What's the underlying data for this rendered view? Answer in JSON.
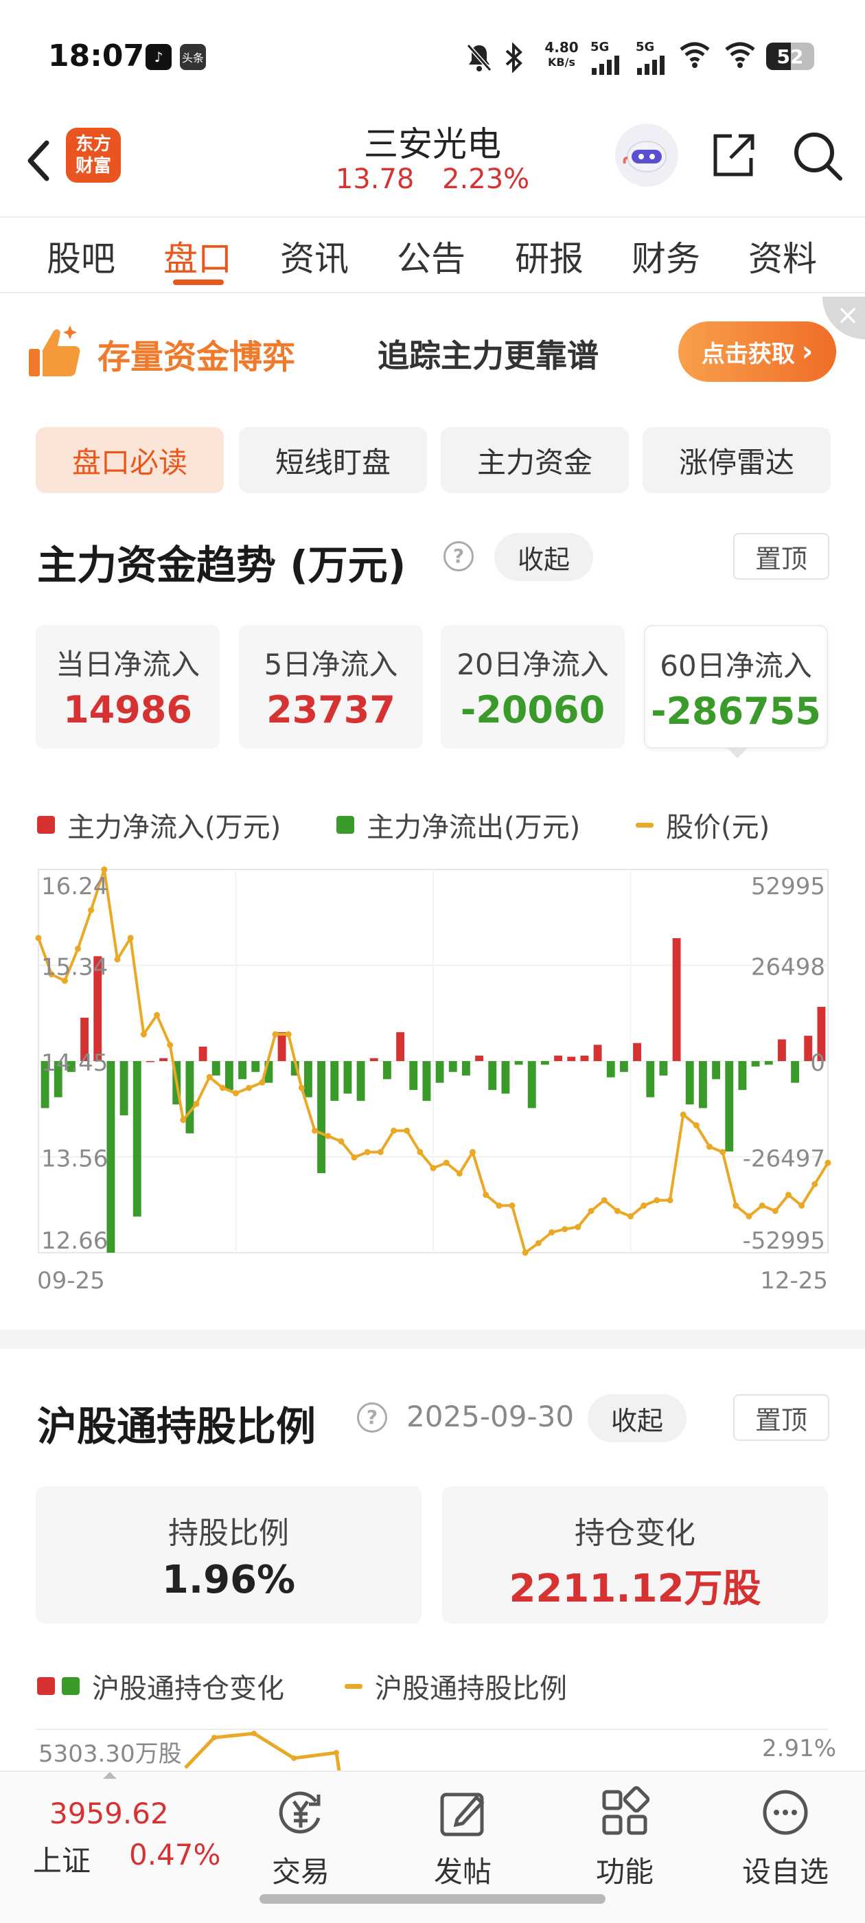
{
  "status_bar": {
    "time": "18:07",
    "net_speed_value": "4.80",
    "net_speed_unit": "KB/s",
    "signal_1": "5G",
    "signal_2": "5G",
    "battery": "52",
    "app_icon_2": "头条"
  },
  "header": {
    "logo_line1": "东方",
    "logo_line2": "财富",
    "stock_name": "三安光电",
    "price": "13.78",
    "change_pct": "2.23%",
    "icons": [
      "back-icon",
      "assistant-robot-icon",
      "share-icon",
      "search-icon"
    ]
  },
  "tabs": [
    "股吧",
    "盘口",
    "资讯",
    "公告",
    "研报",
    "财务",
    "资料"
  ],
  "active_tab": "盘口",
  "banner": {
    "left_text": "存量资金博弈",
    "mid_text": "追踪主力更靠谱",
    "button": "点击获取",
    "button_chevron": "›",
    "close": "×"
  },
  "sub_tabs": [
    "盘口必读",
    "短线盯盘",
    "主力资金",
    "涨停雷达"
  ],
  "active_sub_tab": "盘口必读",
  "fund_trend": {
    "title": "主力资金趋势 (万元)",
    "help": "?",
    "collapse_btn": "收起",
    "pin_btn": "置顶",
    "cards": [
      {
        "label": "当日净流入",
        "value": "14986",
        "tone": "red"
      },
      {
        "label": "5日净流入",
        "value": "23737",
        "tone": "red"
      },
      {
        "label": "20日净流入",
        "value": "-20060",
        "tone": "green"
      },
      {
        "label": "60日净流入",
        "value": "-286755",
        "tone": "green"
      }
    ],
    "legend": [
      "主力净流入(万元)",
      "主力净流出(万元)",
      "股价(元)"
    ]
  },
  "chart_data": {
    "type": "bar",
    "x_start": "09-25",
    "x_end": "12-25",
    "left_axis_ticks": [
      "16.24",
      "15.34",
      "14.45",
      "13.56",
      "12.66"
    ],
    "right_axis_ticks": [
      "52995",
      "26498",
      "0",
      "-26497",
      "-52995"
    ],
    "ylim_price": [
      12.66,
      16.24
    ],
    "ylim_flow": [
      -52995,
      52995
    ],
    "colors": {
      "inflow": "#d63232",
      "outflow": "#3a9b2a",
      "price": "#e9a826"
    },
    "series": [
      {
        "name": "主力净流入(万元)/主力净流出(万元)",
        "values": [
          -13000,
          -10000,
          -3000,
          12000,
          29000,
          -53000,
          -15000,
          -43000,
          0,
          800,
          -12000,
          -20000,
          4000,
          -4000,
          -8000,
          -5000,
          -3000,
          -6000,
          8000,
          -4000,
          -10000,
          -31000,
          -11000,
          -9000,
          -11000,
          800,
          -5000,
          8000,
          -8000,
          -11000,
          -6000,
          -3000,
          -4000,
          1500,
          -8000,
          -9000,
          -1000,
          -13000,
          -1000,
          1500,
          1200,
          1500,
          4500,
          -4500,
          -3000,
          5000,
          -10000,
          -4000,
          34000,
          -12000,
          -13000,
          -5000,
          -25000,
          -8000,
          -1500,
          -1000,
          6000,
          -6000,
          7000,
          15000
        ],
        "type": "bar"
      },
      {
        "name": "股价(元)",
        "values": [
          15.6,
          15.26,
          15.2,
          15.5,
          15.86,
          16.24,
          15.4,
          15.6,
          14.7,
          14.88,
          14.6,
          13.9,
          14.05,
          14.3,
          14.2,
          14.15,
          14.2,
          14.25,
          14.7,
          14.7,
          14.2,
          13.8,
          13.75,
          13.7,
          13.55,
          13.6,
          13.6,
          13.8,
          13.8,
          13.6,
          13.45,
          13.5,
          13.4,
          13.6,
          13.2,
          13.1,
          13.1,
          12.66,
          12.75,
          12.85,
          12.88,
          12.9,
          13.05,
          13.15,
          13.05,
          13.0,
          13.1,
          13.15,
          13.15,
          13.95,
          13.85,
          13.65,
          13.6,
          13.1,
          13.0,
          13.1,
          13.05,
          13.2,
          13.1,
          13.3,
          13.5
        ],
        "type": "line"
      }
    ]
  },
  "hk_connect": {
    "title": "沪股通持股比例",
    "help": "?",
    "date": "2025-09-30",
    "collapse_btn": "收起",
    "pin_btn": "置顶",
    "cards": [
      {
        "label": "持股比例",
        "value": "1.96%",
        "tone": "dark"
      },
      {
        "label": "持仓变化",
        "value": "2211.12万股",
        "tone": "red"
      }
    ],
    "legend": [
      "沪股通持仓变化",
      "沪股通持股比例"
    ],
    "axis_left_top": "5303.30万股",
    "axis_right_top": "2.91%"
  },
  "bottom_bar": {
    "index_value": "3959.62",
    "index_name": "上证",
    "index_change": "0.47%",
    "items": [
      {
        "label": "交易",
        "icon": "trade-yen-icon"
      },
      {
        "label": "发帖",
        "icon": "compose-icon"
      },
      {
        "label": "功能",
        "icon": "grid-icon"
      },
      {
        "label": "设自选",
        "icon": "more-dots-icon"
      }
    ]
  }
}
